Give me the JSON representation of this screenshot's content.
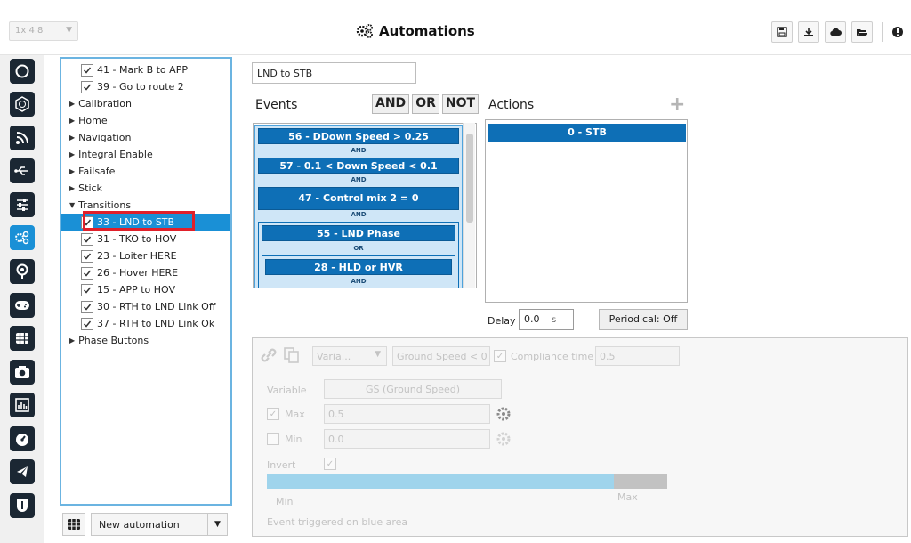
{
  "header": {
    "version": "1x 4.8",
    "title": "Automations",
    "toolbar_icons": [
      "save-icon",
      "download-icon",
      "cloud-icon",
      "folder-open-icon",
      "info-icon"
    ]
  },
  "iconbar": {
    "icons": [
      "power-icon",
      "target-icon",
      "rss-icon",
      "usb-icon",
      "sliders-icon",
      "gears-icon",
      "pin-icon",
      "gamepad-icon",
      "grid-icon",
      "camera-icon",
      "chart-icon",
      "gauge-icon",
      "plane-icon",
      "shield-icon"
    ],
    "active_index": 5
  },
  "tree": {
    "items": [
      {
        "label": "41 - Mark B to APP",
        "type": "check",
        "checked": true,
        "indent": 1
      },
      {
        "label": "39 - Go to route 2",
        "type": "check",
        "checked": true,
        "indent": 1
      },
      {
        "label": "Calibration",
        "type": "folder",
        "expanded": false,
        "indent": 0
      },
      {
        "label": "Home",
        "type": "folder",
        "expanded": false,
        "indent": 0
      },
      {
        "label": "Navigation",
        "type": "folder",
        "expanded": false,
        "indent": 0
      },
      {
        "label": "Integral Enable",
        "type": "folder",
        "expanded": false,
        "indent": 0
      },
      {
        "label": "Failsafe",
        "type": "folder",
        "expanded": false,
        "indent": 0
      },
      {
        "label": "Stick",
        "type": "folder",
        "expanded": false,
        "indent": 0
      },
      {
        "label": "Transitions",
        "type": "folder",
        "expanded": true,
        "indent": 0
      },
      {
        "label": "33 - LND to STB",
        "type": "check",
        "checked": true,
        "indent": 1,
        "selected": true
      },
      {
        "label": "31 - TKO to HOV",
        "type": "check",
        "checked": true,
        "indent": 1
      },
      {
        "label": "23 - Loiter HERE",
        "type": "check",
        "checked": true,
        "indent": 1
      },
      {
        "label": "26 - Hover HERE",
        "type": "check",
        "checked": true,
        "indent": 1
      },
      {
        "label": "15 - APP to HOV",
        "type": "check",
        "checked": true,
        "indent": 1
      },
      {
        "label": "30 - RTH to LND Link Off",
        "type": "check",
        "checked": true,
        "indent": 1
      },
      {
        "label": "37 - RTH to LND Link Ok",
        "type": "check",
        "checked": true,
        "indent": 1
      },
      {
        "label": "Phase Buttons",
        "type": "folder",
        "expanded": false,
        "indent": 0
      }
    ],
    "new_automation_label": "New automation"
  },
  "editor": {
    "name_value": "LND to STB",
    "events_label": "Events",
    "logic": {
      "and": "AND",
      "or": "OR",
      "not": "NOT"
    },
    "actions_label": "Actions",
    "events": {
      "e1": "56 - DDown Speed > 0.25",
      "op1": "AND",
      "e2": "57 - 0.1 < Down Speed < 0.1",
      "op2": "AND",
      "e3": "47 - Control mix 2 = 0",
      "op3": "AND",
      "e4": "55 - LND Phase",
      "op4": "OR",
      "e5": "28 - HLD or HVR",
      "op5": "AND"
    },
    "actions": [
      "0 - STB"
    ],
    "delay_label": "Delay",
    "delay_value": "0.0",
    "delay_unit": "s",
    "periodical_label": "Periodical: Off"
  },
  "condition": {
    "variable_dropdown": "Varia...",
    "condition_dropdown": "Ground Speed < 0",
    "compliance_label": "Compliance time",
    "compliance_value": "0.5",
    "variable_label": "Variable",
    "variable_value": "GS (Ground Speed)",
    "max_label": "Max",
    "max_value": "0.5",
    "min_label": "Min",
    "min_value": "0.0",
    "invert_label": "Invert",
    "bar_min_label": "Min",
    "bar_max_label": "Max",
    "footer": "Event triggered on blue area"
  },
  "colors": {
    "accent": "#1a90d6",
    "chip": "#0e6fb6",
    "highlight": "#e0202a"
  }
}
